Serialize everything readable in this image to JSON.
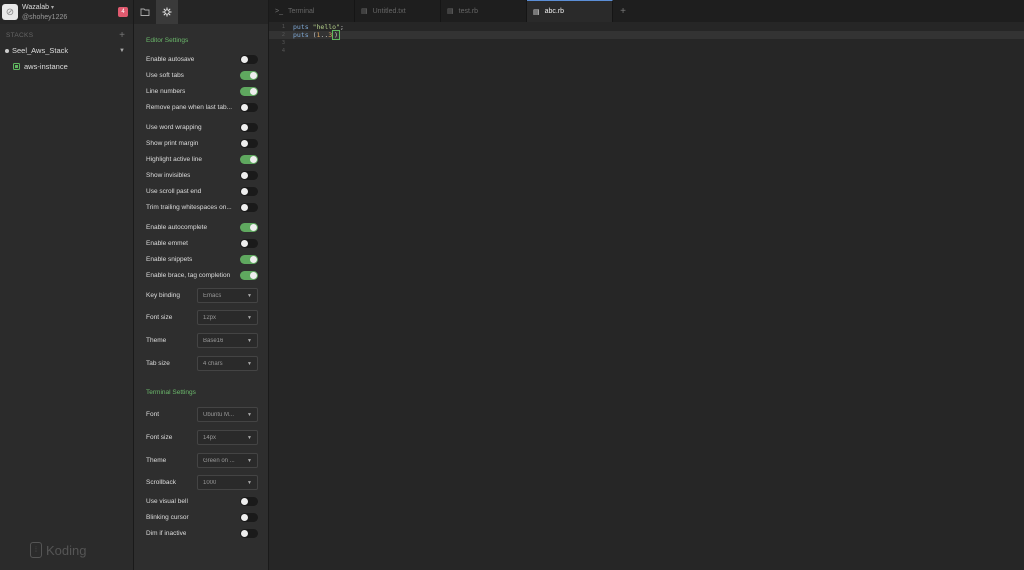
{
  "user": {
    "team": "Wazalab",
    "handle": "@shohey1226",
    "notifications": "4"
  },
  "sidebar": {
    "stacks_label": "STACKS",
    "stack_name": "Seel_Aws_Stack",
    "machine_name": "aws-instance",
    "brand": "Koding"
  },
  "editor_settings": {
    "title": "Editor Settings",
    "toggles": [
      {
        "label": "Enable autosave",
        "on": false
      },
      {
        "label": "Use soft tabs",
        "on": true
      },
      {
        "label": "Line numbers",
        "on": true
      },
      {
        "label": "Remove pane when last tab...",
        "on": false
      },
      {
        "label": "Use word wrapping",
        "on": false
      },
      {
        "label": "Show print margin",
        "on": false
      },
      {
        "label": "Highlight active line",
        "on": true
      },
      {
        "label": "Show invisibles",
        "on": false
      },
      {
        "label": "Use scroll past end",
        "on": false
      },
      {
        "label": "Trim trailing whitespaces on...",
        "on": false
      },
      {
        "label": "Enable autocomplete",
        "on": true
      },
      {
        "label": "Enable emmet",
        "on": false
      },
      {
        "label": "Enable snippets",
        "on": true
      },
      {
        "label": "Enable brace, tag completion",
        "on": true
      }
    ],
    "selects": [
      {
        "label": "Key binding",
        "value": "Emacs"
      },
      {
        "label": "Font size",
        "value": "12px"
      },
      {
        "label": "Theme",
        "value": "Base16"
      },
      {
        "label": "Tab size",
        "value": "4 chars"
      }
    ]
  },
  "terminal_settings": {
    "title": "Terminal Settings",
    "selects": [
      {
        "label": "Font",
        "value": "Ubuntu M..."
      },
      {
        "label": "Font size",
        "value": "14px"
      },
      {
        "label": "Theme",
        "value": "Green on ..."
      },
      {
        "label": "Scrollback",
        "value": "1000"
      }
    ],
    "toggles": [
      {
        "label": "Use visual bell",
        "on": false
      },
      {
        "label": "Blinking cursor",
        "on": false
      },
      {
        "label": "Dim if inactive",
        "on": false
      }
    ]
  },
  "tabs": [
    {
      "label": "Terminal",
      "icon": "terminal-icon",
      "active": false
    },
    {
      "label": "Untitled.txt",
      "icon": "file-icon",
      "active": false
    },
    {
      "label": "test.rb",
      "icon": "file-icon",
      "active": false
    },
    {
      "label": "abc.rb",
      "icon": "file-icon",
      "active": true
    }
  ],
  "code": {
    "line_numbers": [
      "1",
      "2",
      "3",
      "4"
    ],
    "line1": {
      "kw": "puts",
      "str": "\"hello\"",
      "rest": ";"
    },
    "line2": {
      "kw": "puts",
      "open": " (",
      "a": "1",
      "dots": "..",
      "b": "3",
      "close": ")"
    }
  },
  "colors": {
    "accent_green": "#5fa85f",
    "active_tab_border": "#5b8ed6",
    "badge": "#e05a6f"
  }
}
